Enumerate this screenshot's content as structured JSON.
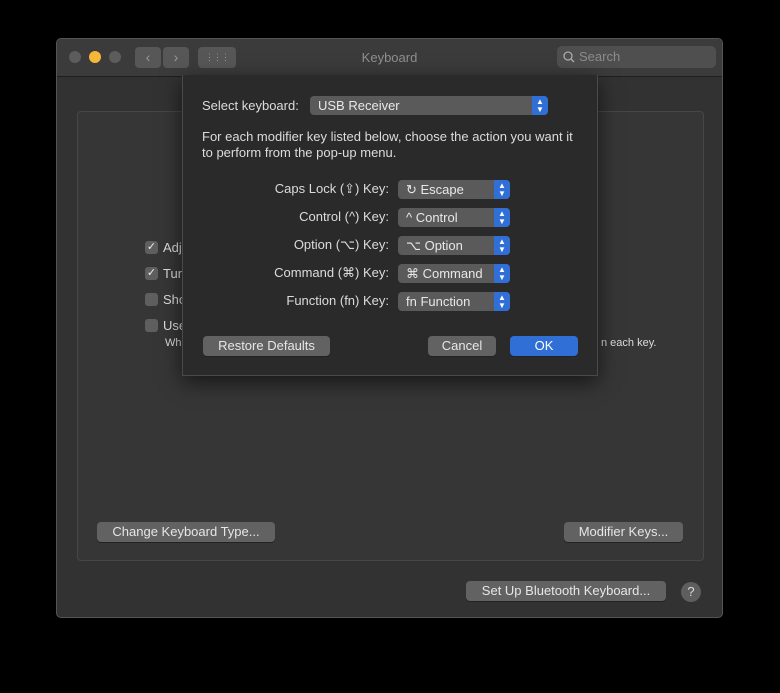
{
  "window": {
    "title": "Keyboard",
    "search_placeholder": "Search",
    "back": "‹",
    "forward": "›",
    "grid": "⋮⋮⋮"
  },
  "background": {
    "checkboxes": [
      {
        "label": "Adj",
        "checked": true
      },
      {
        "label": "Tur",
        "checked": true
      },
      {
        "label": "Sho",
        "checked": false
      },
      {
        "label": "Use",
        "checked": false
      }
    ],
    "hint_left": "Wh",
    "hint_right": "n each key.",
    "change_keyboard_type": "Change Keyboard Type...",
    "modifier_keys": "Modifier Keys...",
    "setup_bluetooth": "Set Up Bluetooth Keyboard...",
    "help": "?"
  },
  "sheet": {
    "select_label": "Select keyboard:",
    "select_value": "USB Receiver",
    "description": "For each modifier key listed below, choose the action you want it to perform from the pop-up menu.",
    "rows": [
      {
        "label": "Caps Lock (⇪) Key:",
        "value": "↻ Escape"
      },
      {
        "label": "Control (^) Key:",
        "value": "^ Control"
      },
      {
        "label": "Option (⌥) Key:",
        "value": "⌥ Option"
      },
      {
        "label": "Command (⌘) Key:",
        "value": "⌘ Command"
      },
      {
        "label": "Function (fn) Key:",
        "value": "fn Function"
      }
    ],
    "restore_defaults": "Restore Defaults",
    "cancel": "Cancel",
    "ok": "OK"
  },
  "colors": {
    "accent": "#2f6fd6",
    "close": "#5c5c5c",
    "minimize": "#f4b737"
  }
}
